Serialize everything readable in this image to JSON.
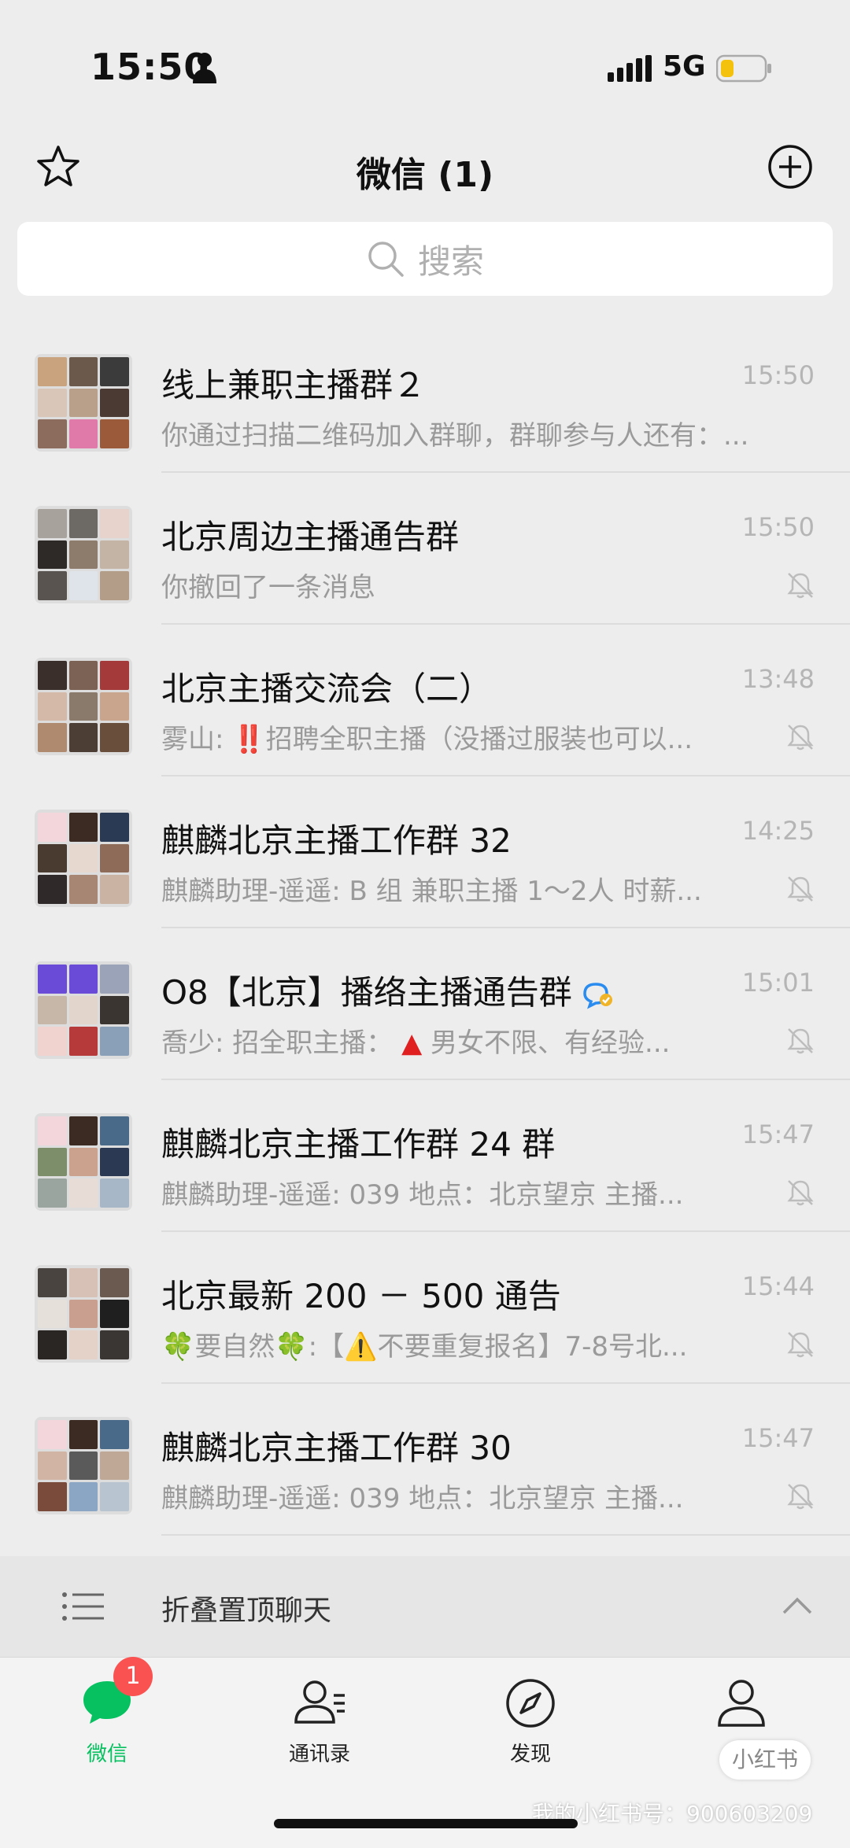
{
  "status": {
    "time": "15:50",
    "network": "5G",
    "battery_color": "#f4c20d"
  },
  "header": {
    "title": "微信 (1)"
  },
  "search": {
    "placeholder": "搜索"
  },
  "chats": [
    {
      "name": "线上兼职主播群２",
      "time": "15:50",
      "msg": "你通过扫描二维码加入群聊，群聊参与人还有：...",
      "muted": false
    },
    {
      "name": "北京周边主播通告群",
      "time": "15:50",
      "msg": "你撤回了一条消息",
      "muted": true
    },
    {
      "name": "北京主播交流会（二）",
      "time": "13:48",
      "msg_prefix": "雾山: ",
      "msg_emoji": "‼️",
      "msg": "招聘全职主播（没播过服装也可以...",
      "muted": true
    },
    {
      "name": "麒麟北京主播工作群 32",
      "time": "14:25",
      "msg": "麒麟助理-遥遥: B 组 兼职主播 1～2人 时薪...",
      "muted": true
    },
    {
      "name": "O8【北京】播络主播通告群",
      "time": "15:01",
      "msg_prefix": "喬少: 招全职主播：  ",
      "msg_emoji": "▲",
      "msg": " 男女不限、有经验...",
      "muted": true
    },
    {
      "name": "麒麟北京主播工作群 24 群",
      "time": "15:47",
      "msg": "麒麟助理-遥遥: 039 地点：北京望京 主播...",
      "muted": true
    },
    {
      "name": "北京最新 200 － 500 通告",
      "time": "15:44",
      "msg": "🍀要自然🍀:【⚠️不要重复报名】7-8号北...",
      "muted": true
    },
    {
      "name": "麒麟北京主播工作群 30",
      "time": "15:47",
      "msg": "麒麟助理-遥遥: 039 地点：北京望京 主播...",
      "muted": true
    }
  ],
  "fold": {
    "label": "折叠置顶聊天"
  },
  "tabs": [
    {
      "label": "微信",
      "icon": "chat-icon",
      "active": true,
      "badge": "1"
    },
    {
      "label": "通讯录",
      "icon": "contacts-icon",
      "active": false
    },
    {
      "label": "发现",
      "icon": "compass-icon",
      "active": false
    },
    {
      "label": "我",
      "icon": "person-icon",
      "active": false
    }
  ],
  "watermark": {
    "logo": "小红书",
    "text": "我的小红书号：900603209"
  },
  "colors": {
    "accent": "#07c160",
    "badge": "#fa5151"
  }
}
